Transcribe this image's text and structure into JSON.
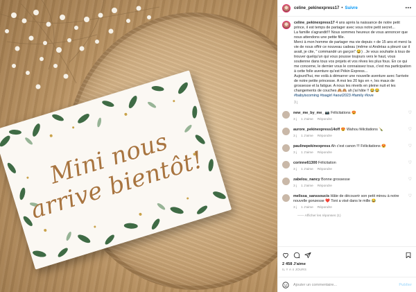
{
  "post": {
    "username": "celine_pekinexpress17",
    "follow_label": "Suivre",
    "more_label": "•••",
    "caption": {
      "text1": "4 ans après la naissance de notre petit prince, il est temps de partager avec vous notre petit secret...",
      "text2": "La famille s'agrandit!!! Nous sommes heureux de vous annoncer que nous attendons une petite fille.",
      "text3": "Merci à mon homme de partager ma vie depuis + de 15 ans et merci la vie de nous offrir ce nouveau cadeau (même si Andréas a pleuré car il avait, je cite, \" commandé un garçon\" 😂) . Je vous souhaite à tous de trouver quelqu'un qui vous pousse toujours vers le haut, vous soutienne dans tous vos projets et vos rêves les plus fous. En ce qui me concerne, le dernier vous le connaissez tous, c'est ma participation à cette folle aventure qu'est Pékin Express...",
      "text4": "Aujourd'hui, me voilà à démarrer une nouvelle aventure avec l'arrivée de notre petite princesse. A moi les 20 kgs en +, les maux de grossesse et la fatigue. A nous les réveils en pleine nuit et les changements de couches 🙈🙈 ah j'ai hâte !! 😂😂",
      "tags": "#babyiscoming #tsagirl #aout2023 #family #love",
      "time": "3 j"
    },
    "comments": [
      {
        "user": "new_me_by_me_",
        "text": "📷 Félicitations 😍",
        "time": "3 j",
        "likes": "1 J'aime",
        "reply": "Répondre"
      },
      {
        "user": "aurore_pekinexpress14off",
        "text": "😍 Wahou félicitations 🍾",
        "time": "3 j",
        "likes": "1 J'aime",
        "reply": "Répondre"
      },
      {
        "user": "paulinepekinexpress",
        "text": "Ah c'est canon !!! Félicitations 😍",
        "time": "3 j",
        "likes": "1 J'aime",
        "reply": "Répondre"
      },
      {
        "user": "corinne61300",
        "text": "Félicitation",
        "time": "3 j",
        "likes": "1 J'aime",
        "reply": "Répondre"
      },
      {
        "user": "zabelou_nancy",
        "text": "Bonne grossesse",
        "time": "3 j",
        "likes": "1 J'aime",
        "reply": "Répondre"
      },
      {
        "user": "melissa_sanssoucis",
        "text": "Hâte de découvrir son petit minou à notre nouvelle gonzesse ❤️ Toni a visé dans le mille 😂",
        "time": "3 j",
        "likes": "1 J'aime",
        "reply": "Répondre"
      }
    ],
    "view_replies": "—— Afficher les réponses (1)",
    "likes_count": "2 458 J'aime",
    "posted_ago": "IL Y A 4 JOURS",
    "add_comment_placeholder": "Ajouter un commentaire...",
    "post_button": "Publier"
  },
  "card": {
    "line1": "Mini nous",
    "line2": "arrive bientôt!"
  },
  "icons": [
    "heart-icon",
    "comment-icon",
    "share-icon",
    "bookmark-icon",
    "emoji-icon"
  ],
  "colors": {
    "follow": "#0095f6",
    "tags": "#00376b",
    "card_text": "#a8743f",
    "leaf": "#3f6b45"
  }
}
